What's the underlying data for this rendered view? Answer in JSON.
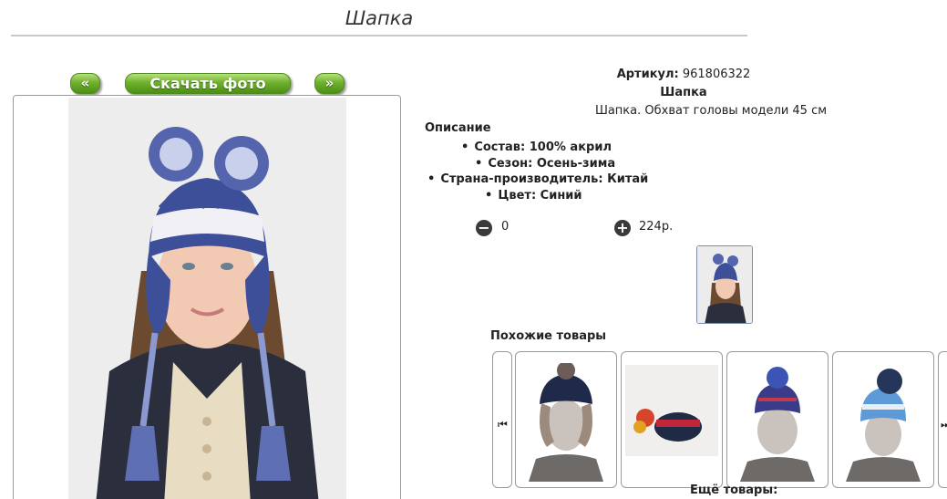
{
  "page": {
    "title": "Шапка"
  },
  "photo_nav": {
    "prev_label": "«",
    "download_label": "Скачать фото",
    "next_label": "»"
  },
  "product": {
    "sku_label": "Артикул:",
    "sku_value": "961806322",
    "name": "Шапка",
    "short_description": "Шапка. Обхват головы модели 45 см",
    "description_heading": "Описание",
    "properties": [
      "Состав: 100% акрил",
      "Сезон: Осень-зима",
      "Страна-производитель: Китай",
      "Цвет: Синий"
    ],
    "quantity": "0",
    "price": "224р."
  },
  "similar": {
    "heading": "Похожие товары",
    "more_label": "Ещё товары:"
  },
  "icons": {
    "minus": "minus-circle-icon",
    "plus": "plus-circle-icon",
    "carousel_prev": "skip-back-icon",
    "carousel_next": "skip-forward-icon"
  },
  "colors": {
    "button_green": "#6fb12d",
    "hat_blue": "#3e4f9a"
  }
}
